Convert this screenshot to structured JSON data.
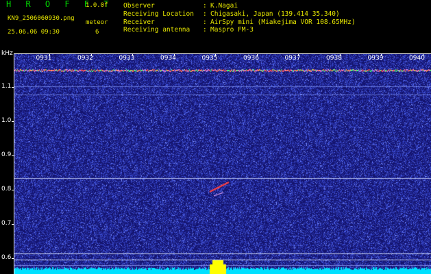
{
  "header": {
    "app_title": "H R O F F T",
    "version": "1.0.0f",
    "filename": "KN9_2506060930.png",
    "meteor_label": "meteor",
    "datetime": "25.06.06 09:30",
    "meteor_count": "6",
    "meta": [
      {
        "label": "Observer",
        "sep": ":",
        "value": "K.Nagai"
      },
      {
        "label": "Receiving Location",
        "sep": ":",
        "value": "Chigasaki, Japan (139.414 35.340)"
      },
      {
        "label": "Receiver",
        "sep": ":",
        "value": "AirSpy mini (Miakejima VOR 108.65MHz)"
      },
      {
        "label": "Receiving antenna",
        "sep": ":",
        "value": "Maspro FM-3"
      }
    ]
  },
  "spectrogram": {
    "y_unit": "kHz",
    "y_ticks": [
      "1.1",
      "1.0",
      "0.9",
      "0.8",
      "0.7",
      "0.6"
    ],
    "y_values": [
      1.1,
      1.0,
      0.9,
      0.8,
      0.7,
      0.6
    ],
    "x_ticks": [
      "0931",
      "0932",
      "0933",
      "0934",
      "0935",
      "0936",
      "0937",
      "0938",
      "0939",
      "0940"
    ],
    "background_color": "#1a1a8e",
    "colors": {
      "carrier": "#ff5050",
      "noise": "#4a5aff",
      "bottom_band": "#00e0ff",
      "burst": "#ffff00",
      "meteor": "#ff4040"
    }
  }
}
